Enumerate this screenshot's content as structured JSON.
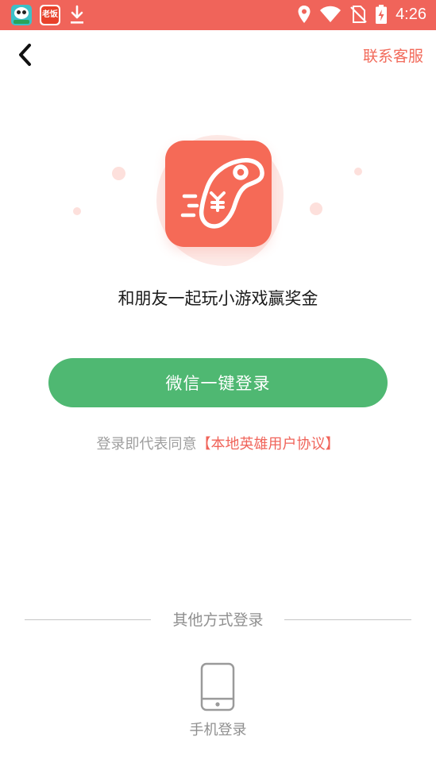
{
  "status_bar": {
    "time": "4:26",
    "left_icons": [
      "panda-app-icon",
      "laofan-app-icon",
      "download-icon"
    ],
    "right_icons": [
      "location-icon",
      "wifi-icon",
      "no-sim-icon",
      "battery-charging-icon"
    ],
    "notification_icon_text": "老饭",
    "background_color": "#f0645a"
  },
  "header": {
    "back_icon": "chevron-left-icon",
    "contact_label": "联系客服"
  },
  "hero": {
    "logo_icon": "gamepad-icon",
    "tagline": "和朋友一起玩小游戏赢奖金"
  },
  "login": {
    "wechat_button_label": "微信一键登录",
    "agreement_prefix": "登录即代表同意",
    "agreement_link": "【本地英雄用户协议】"
  },
  "other_methods": {
    "divider_label": "其他方式登录",
    "phone_icon": "mobile-phone-icon",
    "phone_label": "手机登录"
  },
  "colors": {
    "accent": "#f0645a",
    "wechat_green": "#4fb872",
    "secondary_text": "#9e9e9e"
  }
}
